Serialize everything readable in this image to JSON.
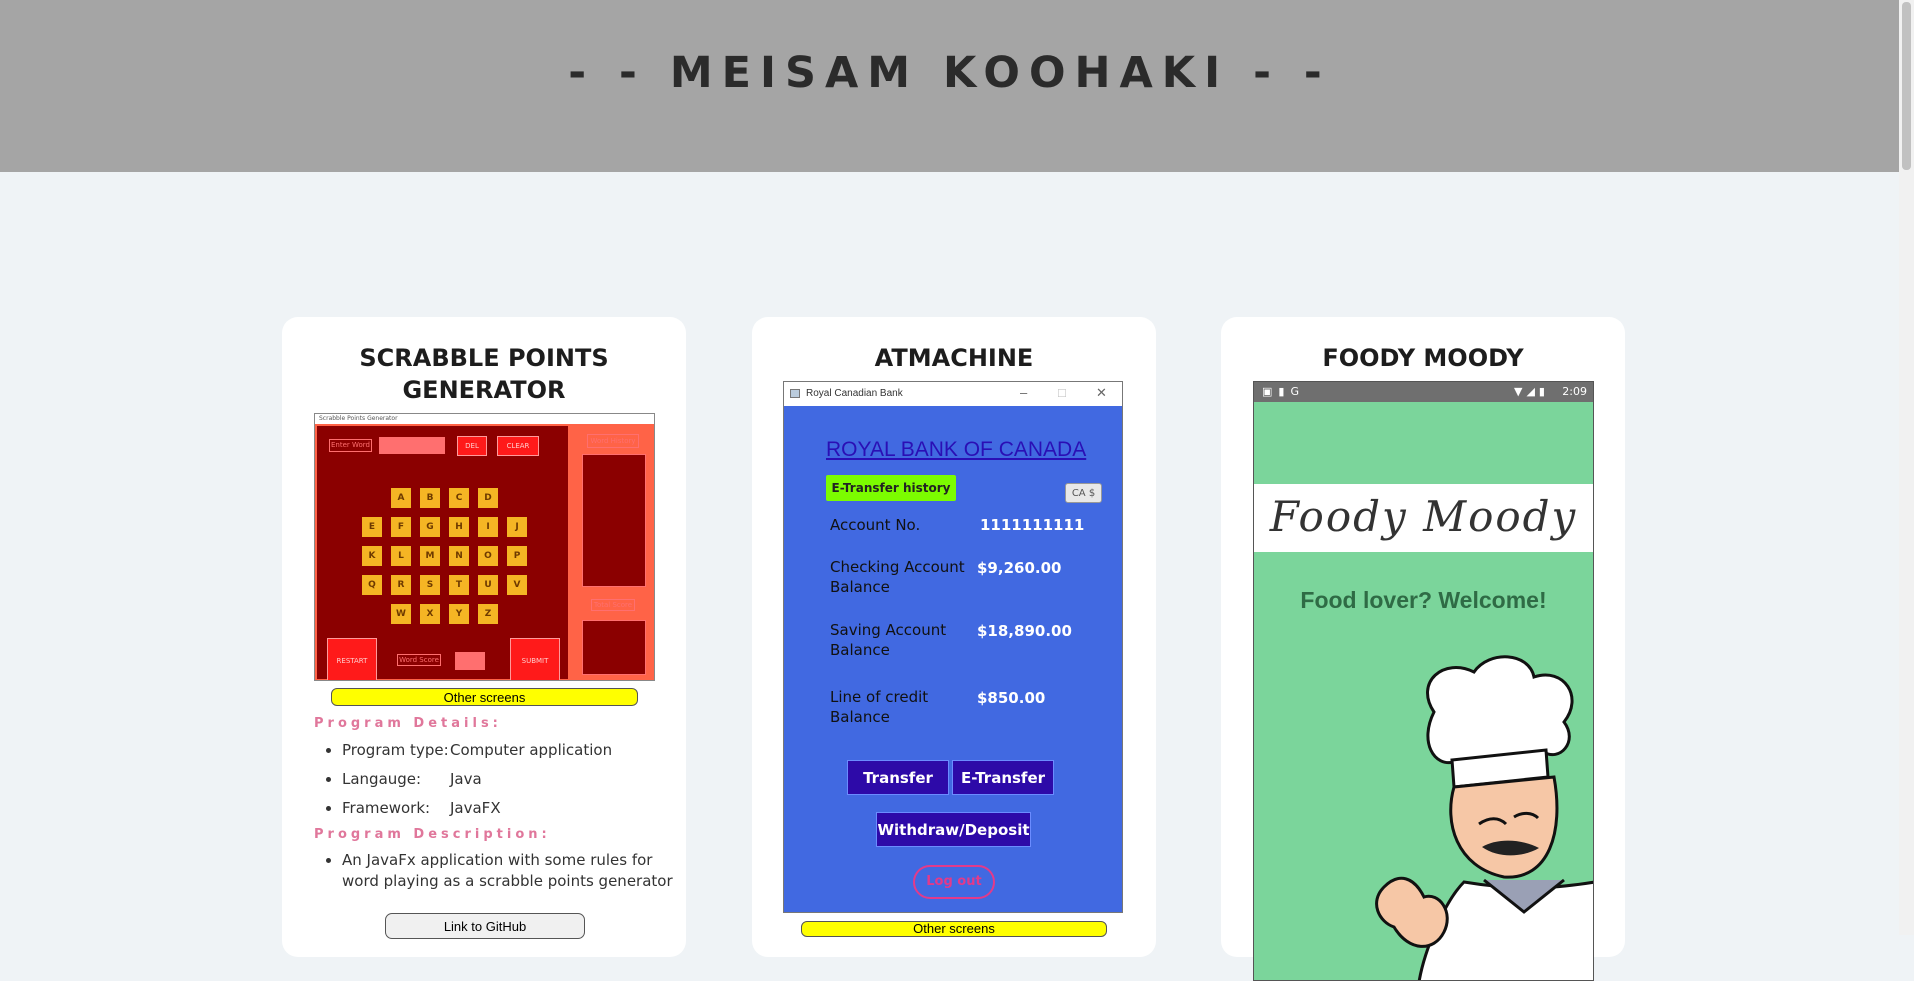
{
  "header": {
    "title": "- - MEISAM KOOHAKI - -"
  },
  "projects": {
    "scrabble": {
      "title": "SCRABBLE POINTS GENERATOR",
      "other_screens": "Other screens",
      "details_label": "Program Details:",
      "details": [
        {
          "key": "Program type:",
          "value": "Computer application"
        },
        {
          "key": "Langauge:",
          "value": "Java"
        },
        {
          "key": "Framework:",
          "value": "JavaFX"
        }
      ],
      "description_label": "Program Description:",
      "description": "An JavaFx application with some rules for word playing as a scrabble points generator",
      "github": "Link to GitHub",
      "screenshot": {
        "window_title": "Scrabble Points Generator",
        "enter_word": "Enter Word",
        "del": "DEL",
        "clear": "CLEAR",
        "word_history": "Word History",
        "total_score": "Total Score",
        "restart": "RESTART",
        "word_score": "Word Score",
        "submit": "SUBMIT",
        "tiles": [
          "A",
          "B",
          "C",
          "D",
          "E",
          "F",
          "G",
          "H",
          "I",
          "J",
          "K",
          "L",
          "M",
          "N",
          "O",
          "P",
          "Q",
          "R",
          "S",
          "T",
          "U",
          "V",
          "W",
          "X",
          "Y",
          "Z"
        ]
      }
    },
    "atm": {
      "title": "ATMACHINE",
      "other_screens": "Other screens",
      "screenshot": {
        "window_title": "Royal Canadian Bank",
        "bank_name": "ROYAL BANK OF CANADA",
        "etransfer_history": "E-Transfer history",
        "lang": "CA $",
        "account_no_label": "Account No.",
        "account_no": "1111111111",
        "checking_label_1": "Checking Account",
        "checking_label_2": "Balance",
        "checking_value": "$9,260.00",
        "saving_label_1": "Saving Account",
        "saving_label_2": "Balance",
        "saving_value": "$18,890.00",
        "credit_label_1": "Line of credit",
        "credit_label_2": "Balance",
        "credit_value": "$850.00",
        "transfer": "Transfer",
        "etransfer": "E-Transfer",
        "withdraw_deposit": "Withdraw/Deposit",
        "logout": "Log out"
      }
    },
    "foody": {
      "title": "FOODY MOODY",
      "screenshot": {
        "time": "2:09",
        "logo": "Foody Moody",
        "welcome": "Food lover? Welcome!"
      }
    }
  },
  "colors": {
    "header_bg": "#a5a5a5",
    "page_bg": "#eff3f6",
    "accent_pink": "#e0779b",
    "other_screens_bg": "#ffff00"
  }
}
